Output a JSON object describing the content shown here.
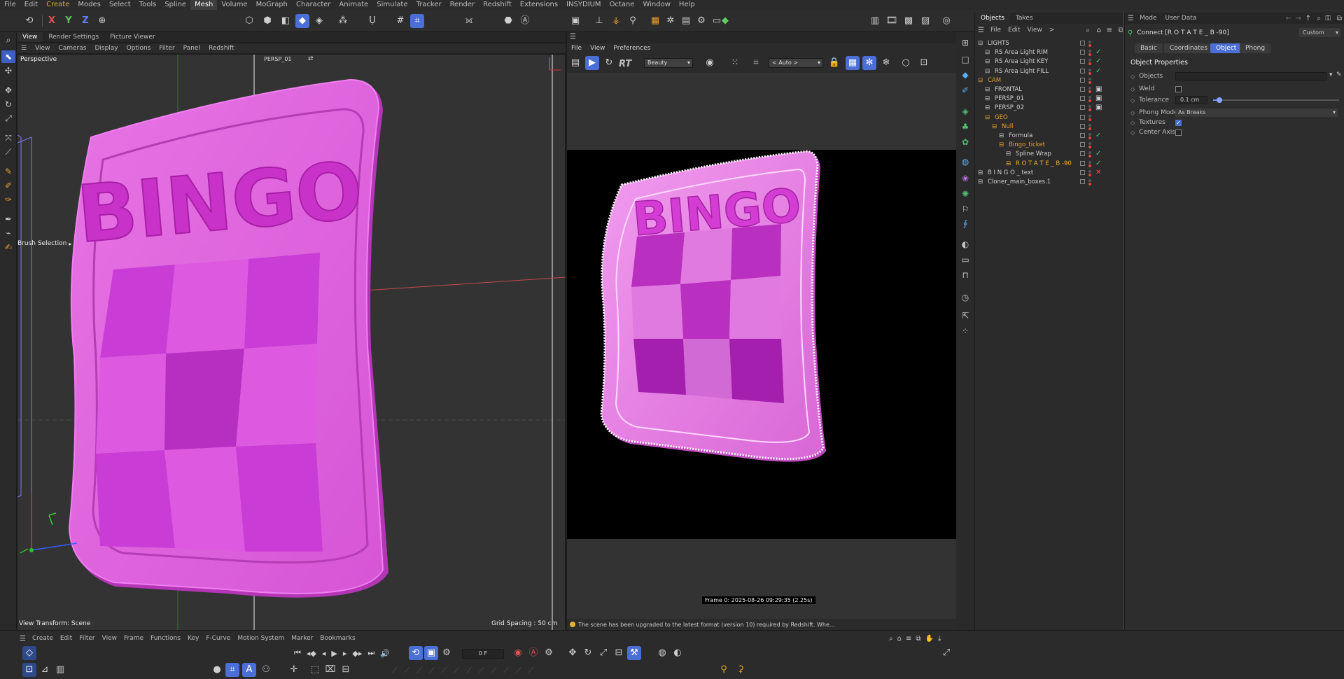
{
  "menu": {
    "items": [
      "File",
      "Edit",
      "Create",
      "Modes",
      "Select",
      "Tools",
      "Spline",
      "Mesh",
      "Volume",
      "MoGraph",
      "Character",
      "Animate",
      "Simulate",
      "Tracker",
      "Render",
      "Redshift",
      "Extensions",
      "INSYDIUM",
      "Octane",
      "Window",
      "Help"
    ],
    "active_index": 2,
    "highlight_index": 7,
    "accent": "#e8a030"
  },
  "toolbar": {
    "axes": [
      "X",
      "Y",
      "Z"
    ]
  },
  "viewport": {
    "tabs": [
      "View",
      "Render Settings",
      "Picture Viewer"
    ],
    "menu": [
      "View",
      "Cameras",
      "Display",
      "Options",
      "Filter",
      "Panel",
      "Redshift"
    ],
    "label": "Perspective",
    "camera": "PERSP_01",
    "brush_label": "Brush Selection",
    "view_transform": "View Transform: Scene",
    "grid_spacing": "Grid Spacing : 50 cm",
    "bingo_text": "BINGO"
  },
  "render_view": {
    "menu": [
      "File",
      "View",
      "Preferences"
    ],
    "rt_label": "RT",
    "aov": "Beauty",
    "auto": "< Auto >",
    "frame_info": "Frame  0:  2025-08-26  09:29:35  (2.25s)",
    "status": "The scene has been upgraded to the latest format (version 10) required by Redshift. Whe..."
  },
  "objects": {
    "tabs": [
      "Objects",
      "Takes"
    ],
    "menu": [
      "File",
      "Edit",
      "View",
      ">"
    ],
    "rows": [
      {
        "name": "LIGHTS",
        "indent": 0,
        "color": "#cfcfcf",
        "tag": ""
      },
      {
        "name": "RS Area Light RIM",
        "indent": 1,
        "color": "#cfcfcf",
        "tag": "✓"
      },
      {
        "name": "RS Area Light KEY",
        "indent": 1,
        "color": "#cfcfcf",
        "tag": "✓"
      },
      {
        "name": "RS Area Light FILL",
        "indent": 1,
        "color": "#cfcfcf",
        "tag": "✓"
      },
      {
        "name": "CAM",
        "indent": 0,
        "color": "#e8a030",
        "tag": ""
      },
      {
        "name": "FRONTAL",
        "indent": 1,
        "color": "#cfcfcf",
        "tag": "▣"
      },
      {
        "name": "PERSP_01",
        "indent": 1,
        "color": "#cfcfcf",
        "tag": "▣"
      },
      {
        "name": "PERSP_02",
        "indent": 1,
        "color": "#cfcfcf",
        "tag": "▣"
      },
      {
        "name": "GEO",
        "indent": 1,
        "color": "#e8a030",
        "tag": ""
      },
      {
        "name": "Null",
        "indent": 2,
        "color": "#e8a030",
        "tag": ""
      },
      {
        "name": "Formula",
        "indent": 3,
        "color": "#cfcfcf",
        "tag": "✓"
      },
      {
        "name": "Bingo_ticket",
        "indent": 3,
        "color": "#e8a030",
        "tag": ""
      },
      {
        "name": "Spline Wrap",
        "indent": 4,
        "color": "#cfcfcf",
        "tag": "✓"
      },
      {
        "name": "R O T A T E _ B -90",
        "indent": 4,
        "color": "#f0b030",
        "tag": "✓"
      },
      {
        "name": "B I N G O _ text",
        "indent": 0,
        "color": "#cfcfcf",
        "tag": "✕"
      },
      {
        "name": "Cloner_main_boxes.1",
        "indent": 0,
        "color": "#cfcfcf",
        "tag": ""
      }
    ]
  },
  "attributes": {
    "top_tabs": [
      "Mode",
      "User Data"
    ],
    "title": "Connect [R O T A T E _ B -90]",
    "preset": "Custom",
    "tabs": [
      "Basic",
      "Coordinates",
      "Object",
      "Phong"
    ],
    "active_tab": "Object",
    "section": "Object Properties",
    "fields": {
      "objects_label": "Objects",
      "weld_label": "Weld",
      "tolerance_label": "Tolerance",
      "tolerance_value": "0.1 cm",
      "phong_label": "Phong Mode",
      "phong_value": "As Breaks",
      "textures_label": "Textures",
      "center_axis_label": "Center Axis"
    },
    "tolerance_fraction": 0.05
  },
  "timeline": {
    "menu": [
      "Create",
      "Edit",
      "Filter",
      "View",
      "Frame",
      "Functions",
      "Key",
      "F-Curve",
      "Motion System",
      "Marker",
      "Bookmarks"
    ],
    "frame": "0 F"
  },
  "colors": {
    "pink_light": "#e46ee0",
    "pink_dark": "#b42ab6",
    "accent_blue": "#4a6fd6"
  }
}
